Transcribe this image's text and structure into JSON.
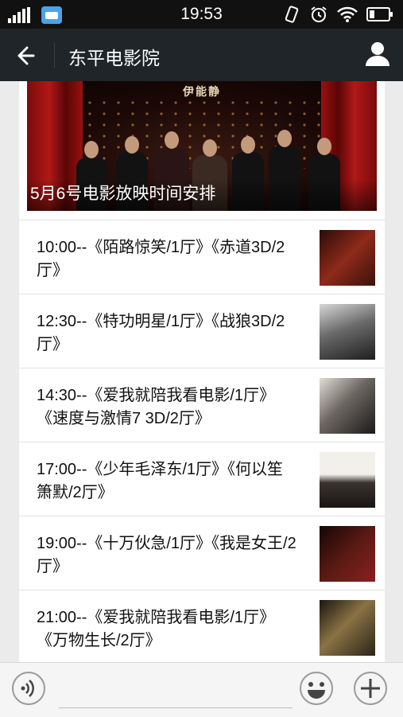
{
  "status_bar": {
    "time": "19:53",
    "icons": [
      "signal-icon",
      "message-app-icon",
      "vibrate-icon",
      "alarm-icon",
      "wifi-icon",
      "battery-icon"
    ]
  },
  "header": {
    "title": "东平电影院",
    "back_icon": "back-arrow-icon",
    "profile_icon": "person-icon"
  },
  "article": {
    "banner": {
      "brand": "伊能静",
      "caption": "5月6号电影放映时间安排"
    },
    "showtimes": [
      {
        "text": "10:00--《陌路惊笑/1厅》《赤道3D/2厅》",
        "thumb_color": "#7a2a1c"
      },
      {
        "text": "12:30--《特功明星/1厅》《战狼3D/2厅》",
        "thumb_color": "#3f3f3f"
      },
      {
        "text": "14:30--《爱我就陪我看电影/1厅》《速度与激情7 3D/2厅》",
        "thumb_color": "#8b8780"
      },
      {
        "text": "17:00--《少年毛泽东/1厅》《何以笙箫默/2厅》",
        "thumb_color": "#d9d6d0"
      },
      {
        "text": "19:00--《十万伙急/1厅》《我是女王/2厅》",
        "thumb_color": "#2a1010"
      },
      {
        "text": "21:00--《爱我就陪我看电影/1厅》《万物生长/2厅》",
        "thumb_color": "#6a5a3a"
      }
    ]
  },
  "input_bar": {
    "placeholder": "",
    "icons": [
      "voice-icon",
      "emoji-icon",
      "plus-icon"
    ]
  }
}
